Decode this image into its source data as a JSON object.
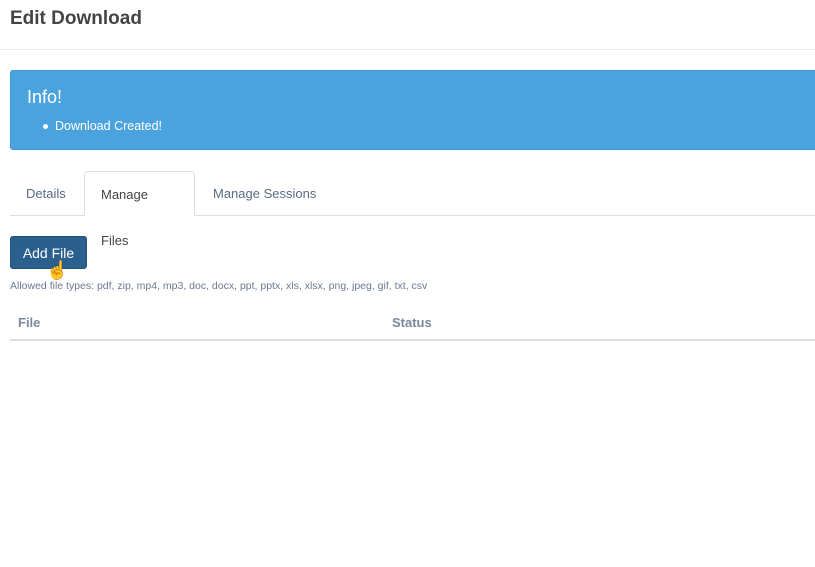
{
  "page": {
    "title": "Edit Download"
  },
  "alert": {
    "heading": "Info!",
    "messages": [
      "Download Created!"
    ],
    "color": "#4aa3df"
  },
  "tabs": [
    {
      "label": "Details"
    },
    {
      "label": "Manage Files",
      "active": true
    },
    {
      "label": "Manage Sessions"
    }
  ],
  "files": {
    "add_label": "Add File",
    "hint": "Allowed file types: pdf, zip, mp4, mp3, doc, docx, ppt, pptx, xls, xlsx, png, jpeg, gif, txt, csv",
    "columns": [
      "File",
      "Status"
    ]
  }
}
